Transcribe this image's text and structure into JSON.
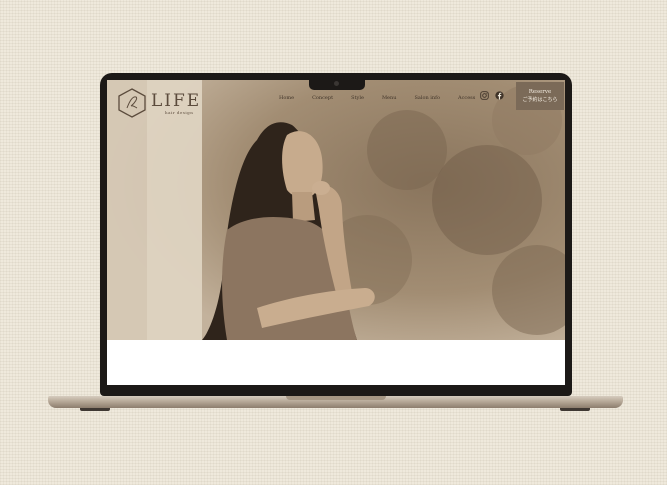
{
  "site": {
    "logo_title": "LIFE",
    "logo_subtitle": "hair design",
    "logo_icon": "hexagon-monogram-icon"
  },
  "nav": {
    "items": [
      {
        "label": "Home"
      },
      {
        "label": "Concept"
      },
      {
        "label": "Style"
      },
      {
        "label": "Menu"
      },
      {
        "label": "Salon info"
      },
      {
        "label": "Access"
      }
    ]
  },
  "social": {
    "icons": [
      "instagram-icon",
      "facebook-icon"
    ]
  },
  "reserve": {
    "label_en": "Reserve",
    "label_jp": "ご予約はこちら"
  },
  "hero": {
    "image": "sepia-portrait-woman"
  },
  "colors": {
    "background": "#efe9dc",
    "bezel": "#1c1917",
    "brand_text": "#5b4b3c",
    "reserve_bg": "#7b6a58",
    "nav_text": "#3f3328"
  }
}
